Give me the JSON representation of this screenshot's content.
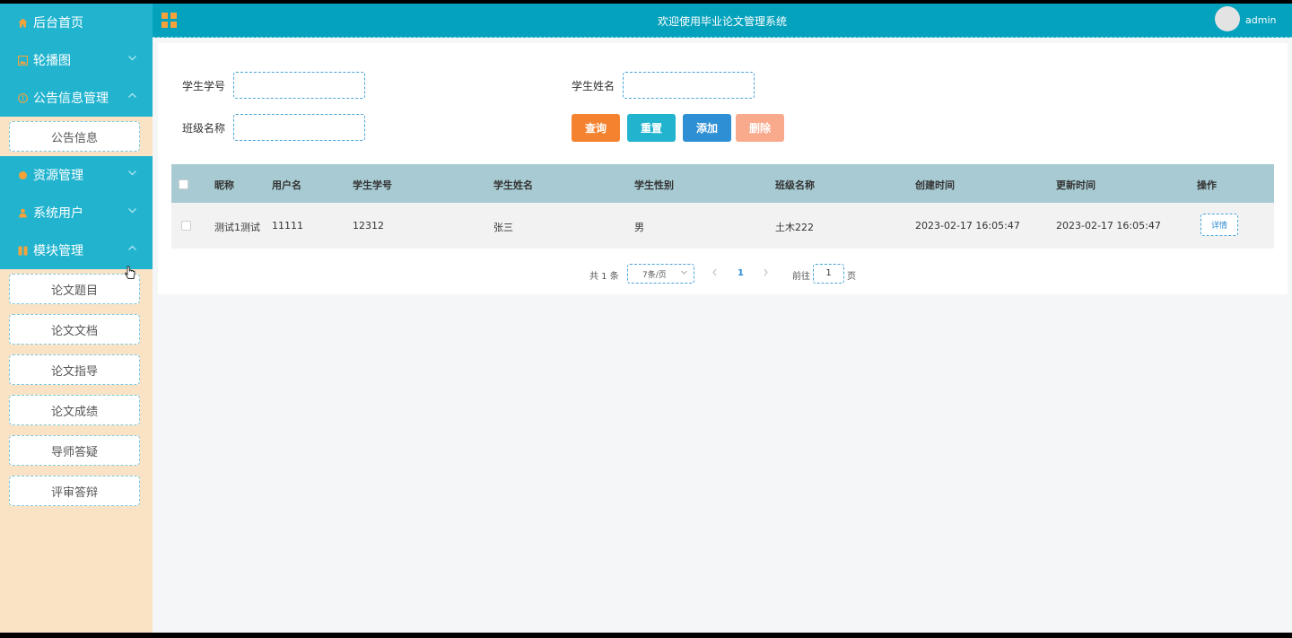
{
  "header": {
    "title": "欢迎使用毕业论文管理系统",
    "username": "admin",
    "accent": "#05a2bd"
  },
  "sidebar": {
    "items": [
      {
        "label": "后台首页",
        "icon": "home-icon"
      },
      {
        "label": "轮播图",
        "icon": "image-icon"
      },
      {
        "label": "公告信息管理",
        "icon": "info-icon",
        "children": [
          "公告信息"
        ]
      },
      {
        "label": "资源管理",
        "icon": "resource-icon"
      },
      {
        "label": "系统用户",
        "icon": "user-icon"
      },
      {
        "label": "模块管理",
        "icon": "module-icon",
        "children": [
          "论文题目",
          "论文文档",
          "论文指导",
          "论文成绩",
          "导师答疑",
          "评审答辩"
        ]
      }
    ]
  },
  "search": {
    "student_id_label": "学生学号",
    "student_name_label": "学生姓名",
    "class_name_label": "班级名称",
    "student_id_value": "",
    "student_name_value": "",
    "class_name_value": ""
  },
  "actions": {
    "query": "查询",
    "reset": "重置",
    "add": "添加",
    "delete": "删除",
    "colors": {
      "query": "#f5822f",
      "reset": "#22b4cf",
      "add": "#2e8fd4",
      "delete": "#f9a98c"
    }
  },
  "table": {
    "columns": [
      "昵称",
      "用户名",
      "学生学号",
      "学生姓名",
      "学生性别",
      "班级名称",
      "创建时间",
      "更新时间",
      "操作"
    ],
    "rows": [
      [
        "测试1测试",
        "11111",
        "12312",
        "张三",
        "男",
        "土木222",
        "2023-02-17 16:05:47",
        "2023-02-17 16:05:47"
      ]
    ],
    "detail_label": "详情"
  },
  "pagination": {
    "total_text": "共 1 条",
    "page_size": "7条/页",
    "current_page": "1",
    "goto_label": "前往",
    "goto_value": "1",
    "page_suffix": "页"
  }
}
